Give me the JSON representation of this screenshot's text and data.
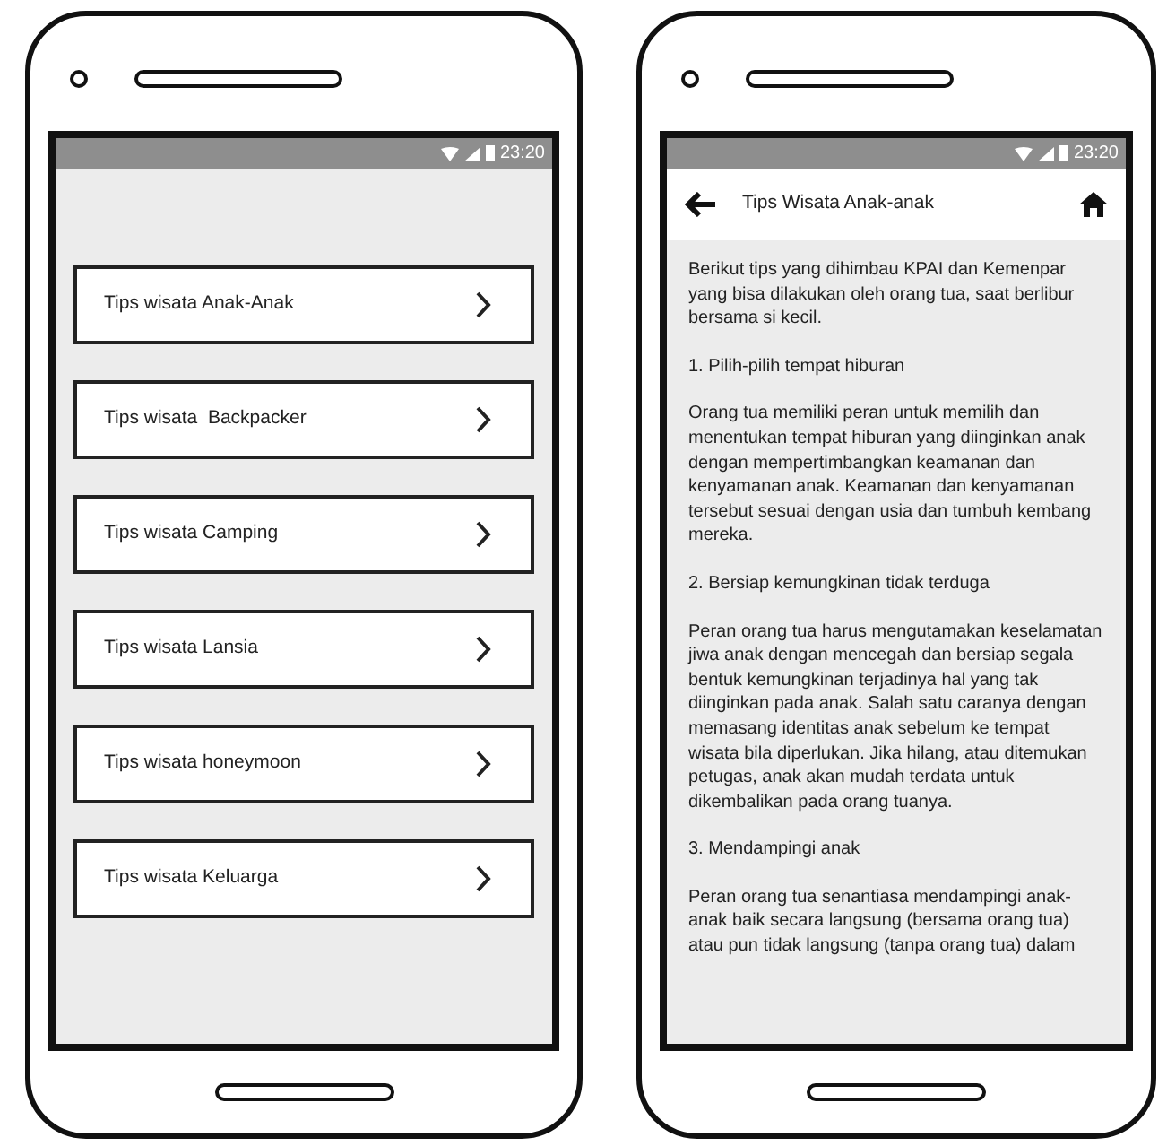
{
  "phones": [
    {
      "kind": "menu",
      "status_time": "23:20",
      "menu": [
        {
          "label": "Tips wisata Anak-Anak"
        },
        {
          "label": "Tips wisata  Backpacker"
        },
        {
          "label": "Tips wisata Camping"
        },
        {
          "label": "Tips wisata Lansia"
        },
        {
          "label": "Tips wisata honeymoon"
        },
        {
          "label": "Tips wisata Keluarga"
        }
      ]
    },
    {
      "kind": "article",
      "status_time": "23:20",
      "header": {
        "title": "Tips Wisata Anak-anak"
      },
      "paragraphs": [
        "Berikut tips yang dihimbau KPAI dan Kemenpar yang bisa dilakukan oleh orang tua, saat berlibur bersama si kecil.",
        "1. Pilih-pilih tempat hiburan",
        "Orang tua memiliki peran untuk memilih dan menentukan tempat hiburan yang diinginkan anak dengan mempertimbangkan keamanan dan kenyamanan anak. Keamanan dan kenyamanan tersebut sesuai dengan usia dan tumbuh kembang mereka.",
        "2. Bersiap kemungkinan tidak terduga",
        "Peran orang tua harus mengutamakan keselamatan jiwa anak dengan mencegah dan bersiap segala bentuk kemungkinan terjadinya hal yang tak diinginkan pada anak. Salah satu caranya dengan memasang identitas anak sebelum ke tempat wisata bila diperlukan. Jika hilang, atau ditemukan petugas, anak akan mudah terdata untuk dikembalikan pada orang tuanya.",
        "3. Mendampingi anak",
        "Peran orang tua senantiasa mendampingi anak-anak baik secara langsung (bersama orang tua) atau pun tidak langsung (tanpa orang tua) dalam"
      ]
    }
  ]
}
